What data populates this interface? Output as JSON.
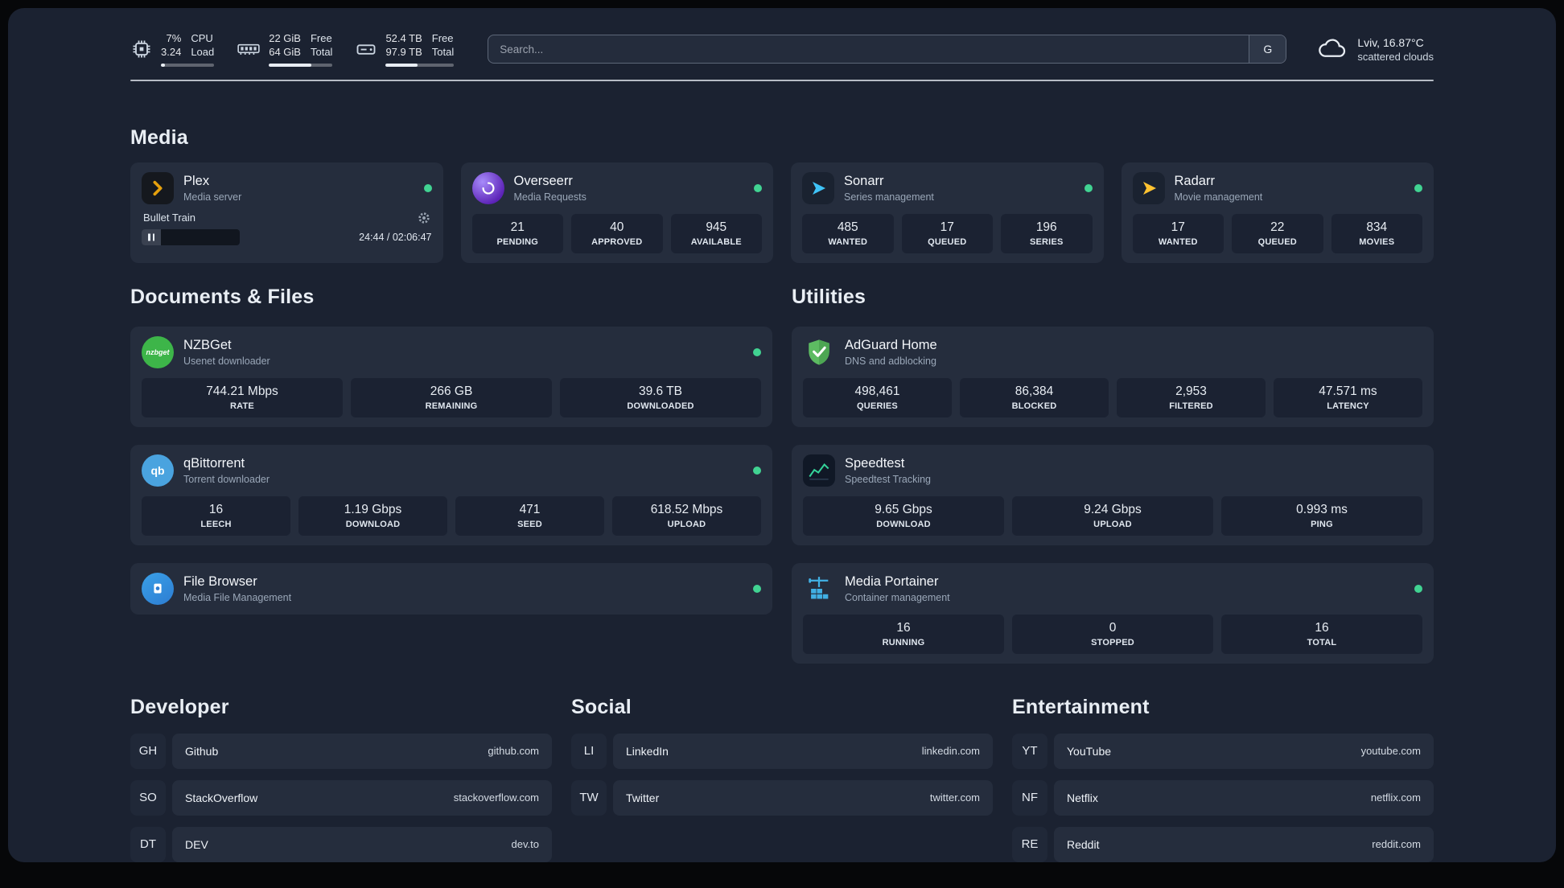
{
  "topbar": {
    "cpu": {
      "value_top": "7%",
      "value_bottom": "3.24",
      "label_top": "CPU",
      "label_bottom": "Load",
      "bar_percent": 7
    },
    "memory": {
      "value_top": "22 GiB",
      "value_bottom": "64 GiB",
      "label_top": "Free",
      "label_bottom": "Total",
      "bar_percent": 66
    },
    "disk": {
      "value_top": "52.4 TB",
      "value_bottom": "97.9 TB",
      "label_top": "Free",
      "label_bottom": "Total",
      "bar_percent": 47
    },
    "search": {
      "placeholder": "Search...",
      "provider": "G"
    },
    "weather": {
      "location": "Lviv, 16.87°C",
      "condition": "scattered clouds"
    }
  },
  "colors": {
    "status_online": "#41d392"
  },
  "sections": {
    "media": {
      "title": "Media",
      "plex": {
        "name": "Plex",
        "desc": "Media server",
        "online": true,
        "player": {
          "track": "Bullet Train",
          "time": "24:44 / 02:06:47",
          "progress_percent": 20
        }
      },
      "overseerr": {
        "name": "Overseerr",
        "desc": "Media Requests",
        "online": true,
        "stats": [
          {
            "value": "21",
            "label": "PENDING"
          },
          {
            "value": "40",
            "label": "APPROVED"
          },
          {
            "value": "945",
            "label": "AVAILABLE"
          }
        ]
      },
      "sonarr": {
        "name": "Sonarr",
        "desc": "Series management",
        "online": true,
        "stats": [
          {
            "value": "485",
            "label": "WANTED"
          },
          {
            "value": "17",
            "label": "QUEUED"
          },
          {
            "value": "196",
            "label": "SERIES"
          }
        ]
      },
      "radarr": {
        "name": "Radarr",
        "desc": "Movie management",
        "online": true,
        "stats": [
          {
            "value": "17",
            "label": "WANTED"
          },
          {
            "value": "22",
            "label": "QUEUED"
          },
          {
            "value": "834",
            "label": "MOVIES"
          }
        ]
      }
    },
    "documents": {
      "title": "Documents & Files",
      "nzbget": {
        "name": "NZBGet",
        "desc": "Usenet downloader",
        "online": true,
        "stats": [
          {
            "value": "744.21 Mbps",
            "label": "RATE"
          },
          {
            "value": "266 GB",
            "label": "REMAINING"
          },
          {
            "value": "39.6 TB",
            "label": "DOWNLOADED"
          }
        ]
      },
      "qbittorrent": {
        "name": "qBittorrent",
        "desc": "Torrent downloader",
        "online": true,
        "stats": [
          {
            "value": "16",
            "label": "LEECH"
          },
          {
            "value": "1.19 Gbps",
            "label": "DOWNLOAD"
          },
          {
            "value": "471",
            "label": "SEED"
          },
          {
            "value": "618.52 Mbps",
            "label": "UPLOAD"
          }
        ]
      },
      "filebrowser": {
        "name": "File Browser",
        "desc": "Media File Management",
        "online": true
      }
    },
    "utilities": {
      "title": "Utilities",
      "adguard": {
        "name": "AdGuard Home",
        "desc": "DNS and adblocking",
        "online": false,
        "stats": [
          {
            "value": "498,461",
            "label": "QUERIES"
          },
          {
            "value": "86,384",
            "label": "BLOCKED"
          },
          {
            "value": "2,953",
            "label": "FILTERED"
          },
          {
            "value": "47.571 ms",
            "label": "LATENCY"
          }
        ]
      },
      "speedtest": {
        "name": "Speedtest",
        "desc": "Speedtest Tracking",
        "online": false,
        "stats": [
          {
            "value": "9.65 Gbps",
            "label": "DOWNLOAD"
          },
          {
            "value": "9.24 Gbps",
            "label": "UPLOAD"
          },
          {
            "value": "0.993 ms",
            "label": "PING"
          }
        ]
      },
      "portainer": {
        "name": "Media Portainer",
        "desc": "Container management",
        "online": true,
        "stats": [
          {
            "value": "16",
            "label": "RUNNING"
          },
          {
            "value": "0",
            "label": "STOPPED"
          },
          {
            "value": "16",
            "label": "TOTAL"
          }
        ]
      }
    }
  },
  "bookmarks": {
    "developer": {
      "title": "Developer",
      "items": [
        {
          "abbr": "GH",
          "name": "Github",
          "url": "github.com"
        },
        {
          "abbr": "SO",
          "name": "StackOverflow",
          "url": "stackoverflow.com"
        },
        {
          "abbr": "DT",
          "name": "DEV",
          "url": "dev.to"
        }
      ]
    },
    "social": {
      "title": "Social",
      "items": [
        {
          "abbr": "LI",
          "name": "LinkedIn",
          "url": "linkedin.com"
        },
        {
          "abbr": "TW",
          "name": "Twitter",
          "url": "twitter.com"
        }
      ]
    },
    "entertainment": {
      "title": "Entertainment",
      "items": [
        {
          "abbr": "YT",
          "name": "YouTube",
          "url": "youtube.com"
        },
        {
          "abbr": "NF",
          "name": "Netflix",
          "url": "netflix.com"
        },
        {
          "abbr": "RE",
          "name": "Reddit",
          "url": "reddit.com"
        }
      ]
    }
  }
}
